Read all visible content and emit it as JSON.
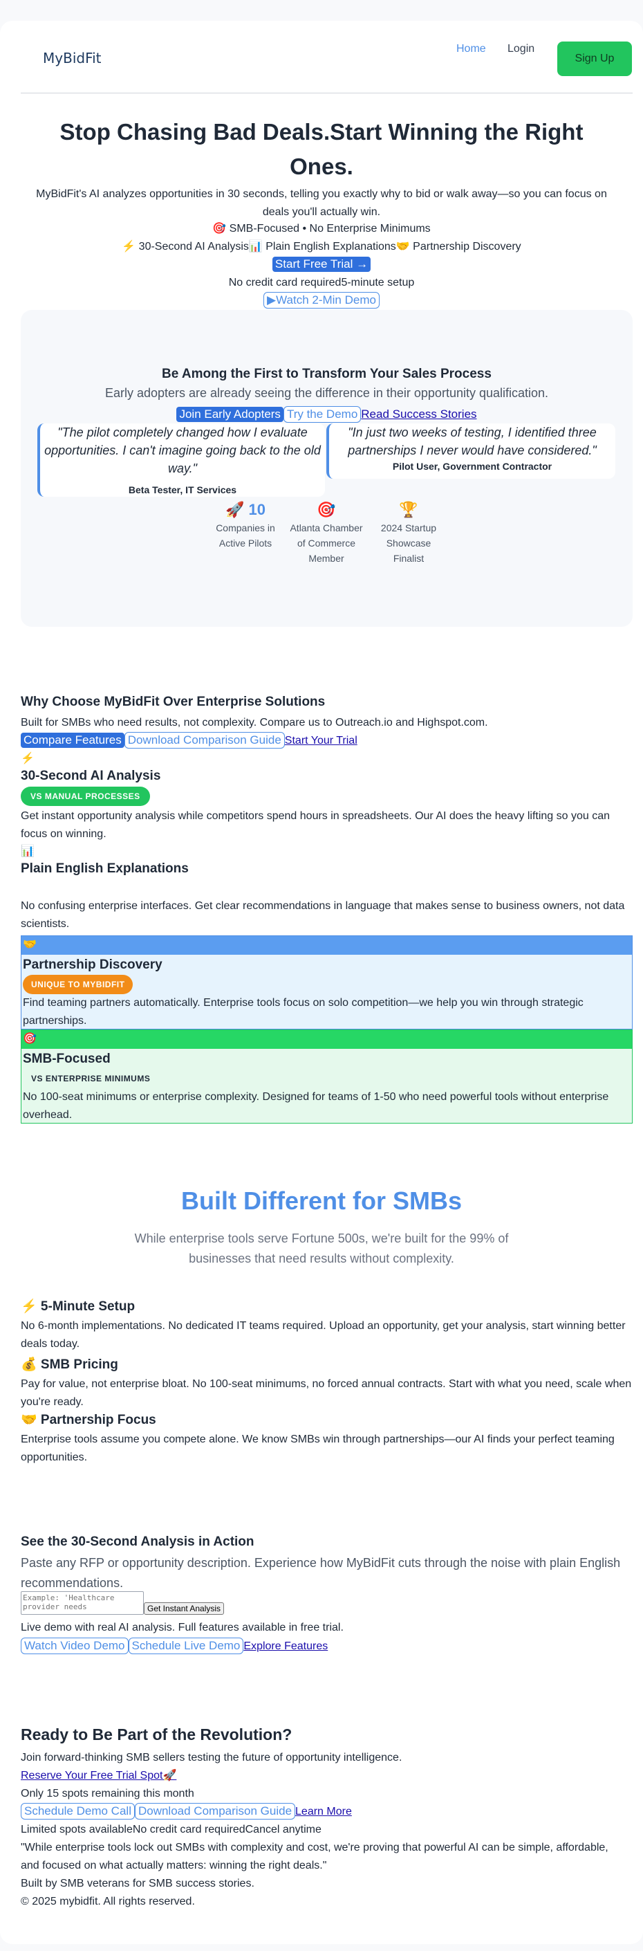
{
  "nav": {
    "logo": "MyBidFit",
    "home": "Home",
    "login": "Login",
    "signup": "Sign Up"
  },
  "hero": {
    "title": "Stop Chasing Bad Deals.Start Winning the Right Ones.",
    "subtitle": "MyBidFit's AI analyzes opportunities in 30 seconds, telling you exactly why to bid or walk away—so you can focus on deals you'll actually win.",
    "tagline": "🎯 SMB-Focused • No Enterprise Minimums",
    "features": [
      "⚡ 30-Second AI Analysis",
      "📊 Plain English Explanations",
      "🤝 Partnership Discovery"
    ],
    "cta_primary": "Start Free Trial →",
    "notes": [
      "No credit card required",
      "5-minute setup"
    ],
    "cta_demo": "▶Watch 2-Min Demo"
  },
  "early_adopters": {
    "title": "Be Among the First to Transform Your Sales Process",
    "subtitle": "Early adopters are already seeing the difference in their opportunity qualification.",
    "cta_join": "Join Early Adopters",
    "cta_demo": "Try the Demo",
    "cta_stories": "Read Success Stories",
    "testimonials": [
      {
        "quote": "\"The pilot completely changed how I evaluate opportunities. I can't imagine going back to the old way.\"",
        "author": "Beta Tester, IT Services"
      },
      {
        "quote": "\"In just two weeks of testing, I identified three partnerships I never would have considered.\"",
        "author": "Pilot User, Government Contractor"
      }
    ],
    "stats": [
      {
        "icon": "🚀",
        "value": "10",
        "label": "Companies in Active Pilots"
      },
      {
        "icon": "🎯",
        "value": "",
        "label": "Atlanta Chamber of Commerce Member"
      },
      {
        "icon": "🏆",
        "value": "",
        "label": "2024 Startup Showcase Finalist"
      }
    ]
  },
  "why": {
    "title": "Why Choose MyBidFit Over Enterprise Solutions",
    "subtitle": "Built for SMBs who need results, not complexity. Compare us to Outreach.io and Highspot.com.",
    "cta_compare": "Compare Features",
    "cta_guide": "Download Comparison Guide",
    "cta_trial": "Start Your Trial",
    "features": [
      {
        "icon": "⚡",
        "title": "30-Second AI Analysis",
        "badge": "VS MANUAL PROCESSES",
        "text": "Get instant opportunity analysis while competitors spend hours in spreadsheets. Our AI does the heavy lifting so you can focus on winning."
      },
      {
        "icon": "📊",
        "title": "Plain English Explanations",
        "badge": "",
        "text": "No confusing enterprise interfaces. Get clear recommendations in language that makes sense to business owners, not data scientists."
      },
      {
        "icon": "🤝",
        "title": "Partnership Discovery",
        "badge": "UNIQUE TO MYBIDFIT",
        "text": "Find teaming partners automatically. Enterprise tools focus on solo competition—we help you win through strategic partnerships."
      },
      {
        "icon": "🎯",
        "title": "SMB-Focused",
        "badge": "VS ENTERPRISE MINIMUMS",
        "text": "No 100-seat minimums or enterprise complexity. Designed for teams of 1-50 who need powerful tools without enterprise overhead."
      }
    ]
  },
  "built": {
    "title": "Built Different for SMBs",
    "subtitle": "While enterprise tools serve Fortune 500s, we're built for the 99% of businesses that need results without complexity.",
    "items": [
      {
        "title": "⚡ 5-Minute Setup",
        "text": "No 6-month implementations. No dedicated IT teams required. Upload an opportunity, get your analysis, start winning better deals today."
      },
      {
        "title": "💰 SMB Pricing",
        "text": "Pay for value, not enterprise bloat. No 100-seat minimums, no forced annual contracts. Start with what you need, scale when you're ready."
      },
      {
        "title": "🤝 Partnership Focus",
        "text": "Enterprise tools assume you compete alone. We know SMBs win through partnerships—our AI finds your perfect teaming opportunities."
      }
    ]
  },
  "demo": {
    "title": "See the 30-Second Analysis in Action",
    "subtitle": "Paste any RFP or opportunity description. Experience how MyBidFit cuts through the noise with plain English recommendations.",
    "placeholder": "Example: 'Healthcare provider needs",
    "button": "Get Instant Analysis",
    "note": "Live demo with real AI analysis. Full features available in free trial.",
    "cta_video": "Watch Video Demo",
    "cta_live": "Schedule Live Demo",
    "cta_explore": "Explore Features"
  },
  "revolution": {
    "title": "Ready to Be Part of the Revolution?",
    "subtitle": "Join forward-thinking SMB sellers testing the future of opportunity intelligence.",
    "cta_reserve": "Reserve Your Free Trial Spot🚀",
    "spots": "Only 15 spots remaining this month",
    "cta_call": "Schedule Demo Call",
    "cta_guide": "Download Comparison Guide",
    "cta_learn": "Learn More",
    "notes": [
      "Limited spots available",
      "No credit card required",
      "Cancel anytime"
    ],
    "quote": "\"While enterprise tools lock out SMBs with complexity and cost, we're proving that powerful AI can be simple, affordable, and focused on what actually matters: winning the right deals.\"",
    "built_by": "Built by SMB veterans for SMB success stories.",
    "copyright": "© 2025 mybidfit. All rights reserved."
  },
  "colors": {
    "accent": "#4f8fe6",
    "green": "#22c55e",
    "orange": "#f28c18"
  }
}
